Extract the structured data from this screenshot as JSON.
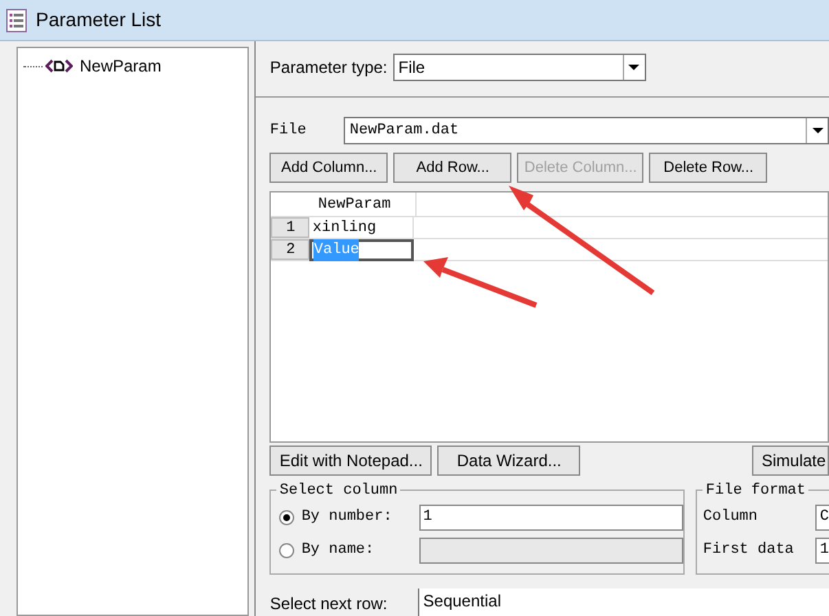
{
  "window": {
    "title": "Parameter List"
  },
  "tree": {
    "items": [
      {
        "label": "NewParam"
      }
    ]
  },
  "parameter_type": {
    "label": "Parameter type:",
    "value": "File"
  },
  "file": {
    "label": "File",
    "value": "NewParam.dat"
  },
  "buttons": [
    {
      "label": "Add Column...",
      "disabled": false
    },
    {
      "label": "Add Row...",
      "disabled": false
    },
    {
      "label": "Delete Column...",
      "disabled": true
    },
    {
      "label": "Delete Row...",
      "disabled": false
    }
  ],
  "grid": {
    "columns": [
      "NewParam"
    ],
    "rows": [
      {
        "number": "1",
        "value": "xinling",
        "editing": false
      },
      {
        "number": "2",
        "value": "Value",
        "editing": true
      }
    ]
  },
  "bottom_buttons": [
    "Edit with Notepad...",
    "Data Wizard...",
    "Simulate"
  ],
  "select_column": {
    "title": "Select column",
    "options": [
      {
        "label": "By number:",
        "selected": true,
        "value": "1"
      },
      {
        "label": "By name:",
        "selected": false
      }
    ]
  },
  "file_format": {
    "title": "File format",
    "fields": [
      {
        "label": "Column",
        "value": "C"
      },
      {
        "label": "First data",
        "value": "1"
      }
    ]
  },
  "select_next_row": {
    "label": "Select next row:",
    "value": "Sequential"
  }
}
